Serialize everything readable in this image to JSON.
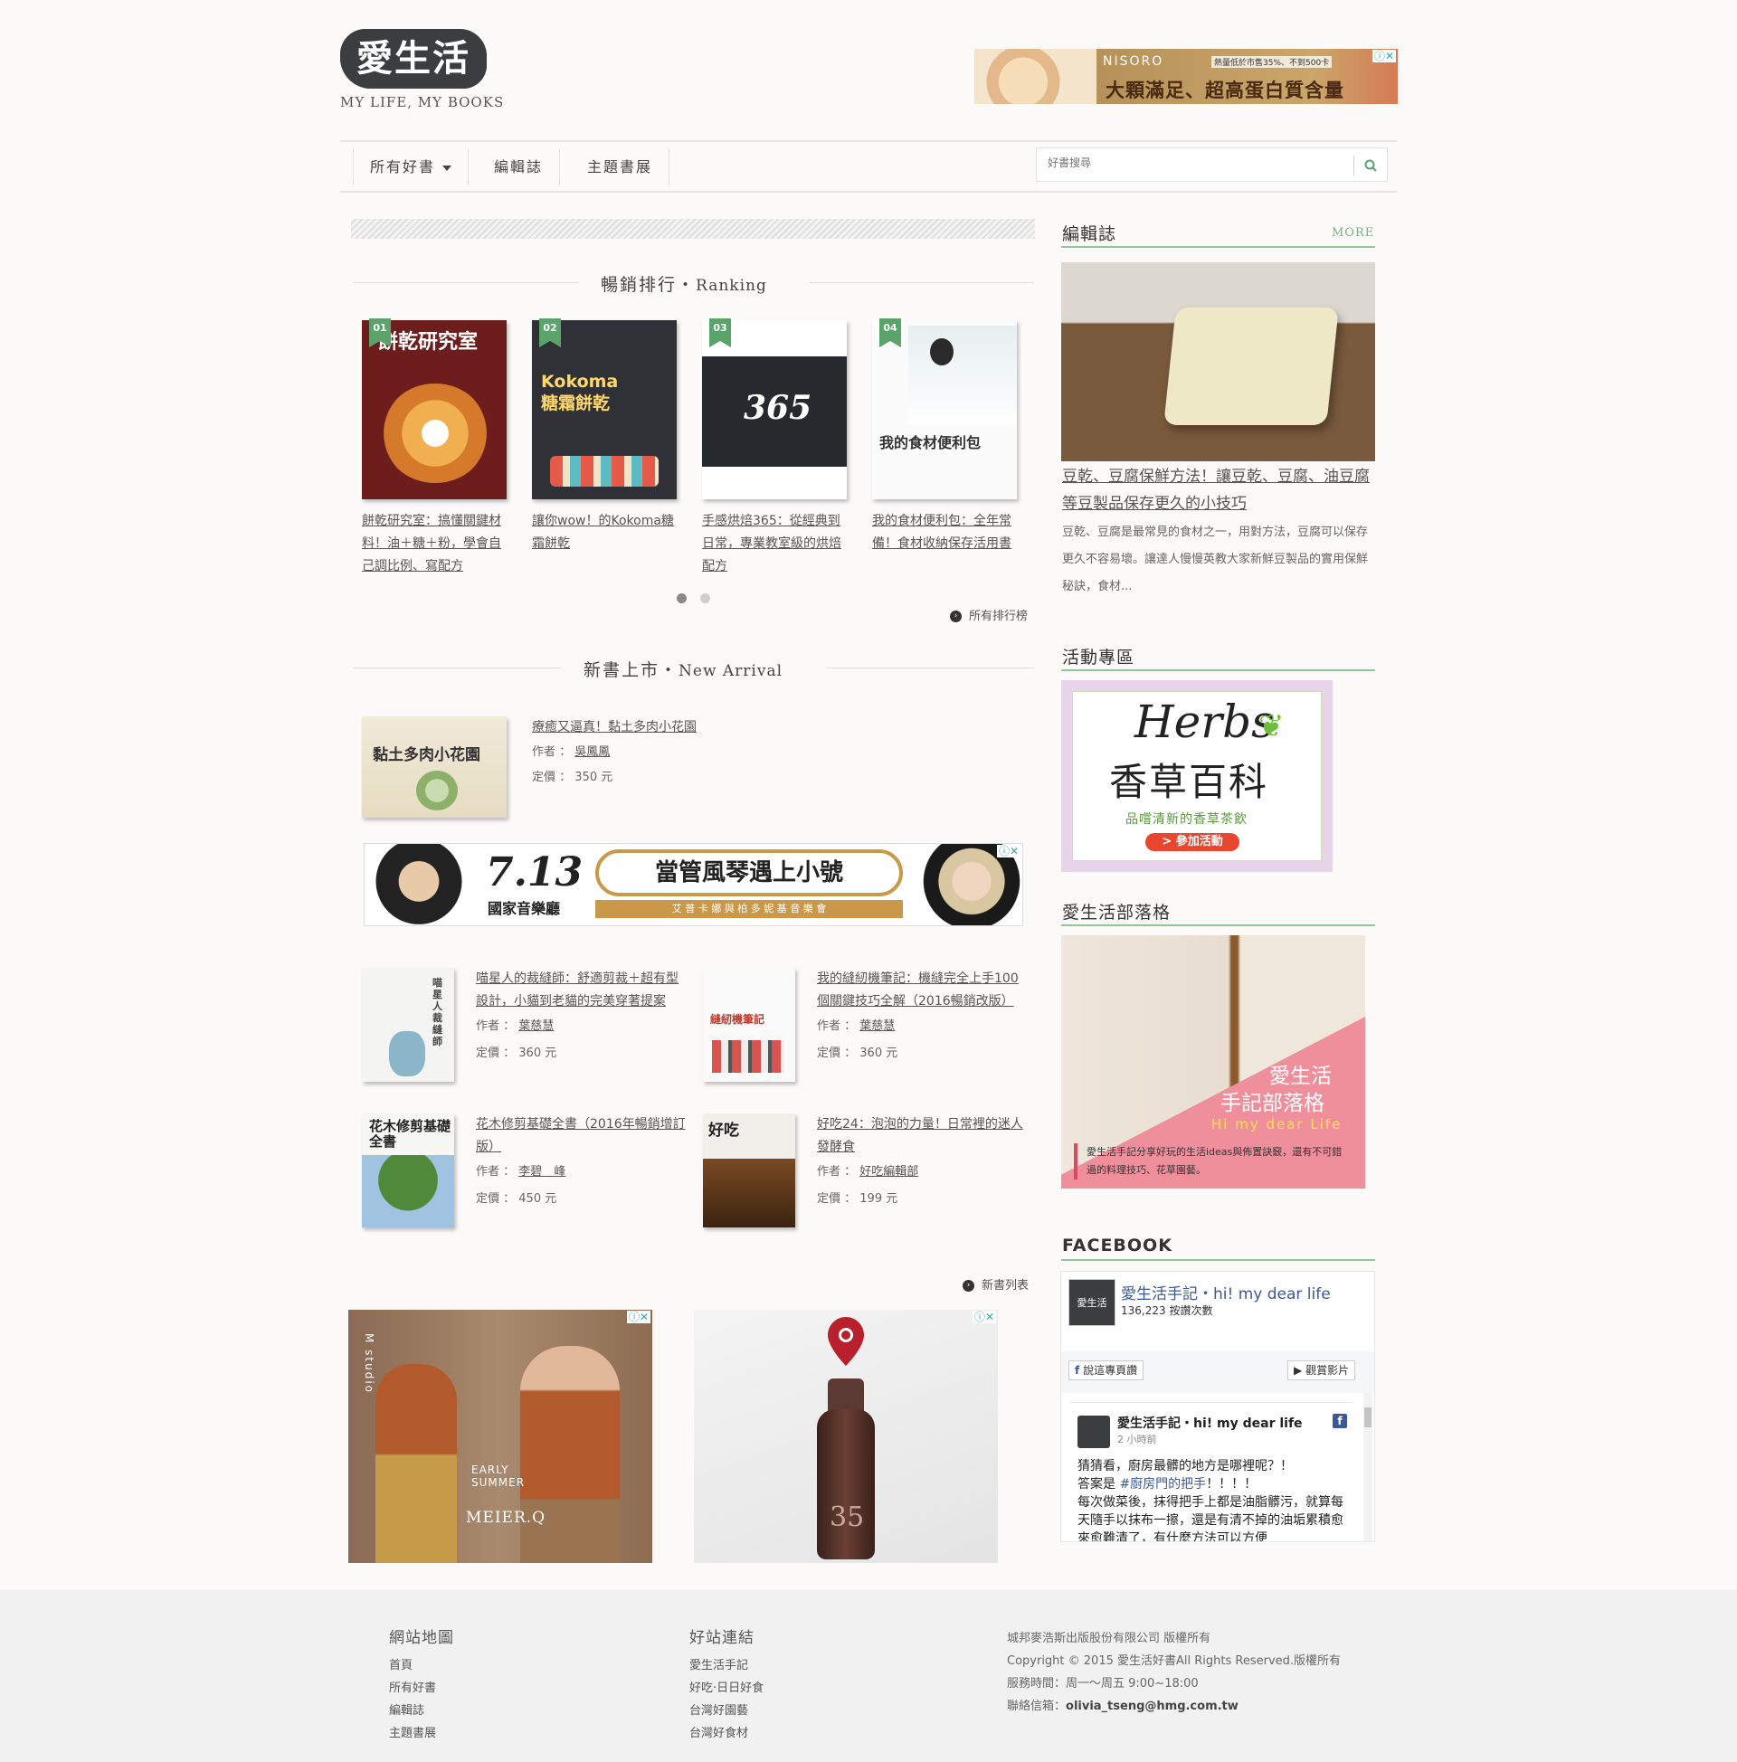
{
  "header": {
    "logo": "愛生活",
    "tagline": "MY LIFE, MY BOOKS",
    "top_ad": {
      "brand": "NISORO",
      "small": "熱量低於市售35%、不到500卡",
      "main": "大顆滿足、超高蛋白質含量"
    }
  },
  "nav": {
    "items": [
      "所有好書",
      "編輯誌",
      "主題書展"
    ],
    "search_placeholder": "好書搜尋"
  },
  "ranking": {
    "title_zh": "暢銷排行・",
    "title_en": "Ranking",
    "books": [
      {
        "rank": "01",
        "cover_text": "餅乾研究室",
        "title": "餅乾研究室：搞懂關鍵材料！油＋糖＋粉，學會自己調比例、寫配方"
      },
      {
        "rank": "02",
        "cover_text": "Kokoma 糖霜餅乾",
        "title": "讓你wow！的Kokoma糖霜餅乾"
      },
      {
        "rank": "03",
        "cover_text": "365",
        "title": "手感烘焙365：從經典到日常，專業教室級的烘焙配方"
      },
      {
        "rank": "04",
        "cover_text": "我的食材便利包",
        "title": "我的食材便利包：全年常備！食材收納保存活用書"
      }
    ],
    "more": "所有排行榜"
  },
  "new_arrival": {
    "title_zh": "新書上市・",
    "title_en": "New Arrival",
    "author_label": "作者 ：",
    "price_label": "定價 ：",
    "featured": {
      "cover_text": "黏土多肉小花園",
      "title": "療癒又逼真！黏土多肉小花園",
      "author": "吳鳳鳳",
      "price": "350 元"
    },
    "books": [
      {
        "cover_text": "喵星人裁縫師",
        "title": "喵星人的裁縫師：舒適剪裁＋超有型設計，小貓到老貓的完美穿著提案",
        "author": "葉慈慧",
        "price": "360 元"
      },
      {
        "cover_text": "縫紉機筆記",
        "title": "我的縫紉機筆記：機縫完全上手100個關鍵技巧全解（2016暢銷改版）",
        "author": "葉慈慧",
        "price": "360 元"
      },
      {
        "cover_text": "花木修剪基礎全書",
        "title": "花木修剪基礎全書（2016年暢銷增訂版）",
        "author": "李碧　峰",
        "price": "450 元"
      },
      {
        "cover_text": "好吃",
        "title": "好吃24：泡泡的力量！日常裡的迷人發酵食",
        "author": "好吃編輯部",
        "price": "199 元"
      }
    ],
    "more": "新書列表"
  },
  "mid_ad": {
    "date": "7.13",
    "venue": "國家音樂廳",
    "headline": "當管風琴遇上小號",
    "sub": "艾 普 卡 娜 與 柏 多 妮 基 音 樂 會"
  },
  "bottom_ads": [
    {
      "brand": "M studio",
      "season": "EARLY SUMMER",
      "name": "MEIER.Q"
    },
    {
      "label": "35"
    }
  ],
  "sidebar": {
    "magazine": {
      "heading": "編輯誌",
      "more": "MORE",
      "article_title": "豆乾、豆腐保鮮方法！讓豆乾、豆腐、油豆腐等豆製品保存更久的小技巧",
      "excerpt": "豆乾、豆腐是最常見的食材之一，用對方法，豆腐可以保存更久不容易壞。讓達人慢慢英教大家新鮮豆製品的實用保鮮秘訣，食材..."
    },
    "events": {
      "heading": "活動專區",
      "banner_en": "Herbs",
      "banner_zh": "香草百科",
      "banner_sub": "品嚐清新的香草茶飲",
      "banner_btn": "> 參加活動"
    },
    "blog": {
      "heading": "愛生活部落格",
      "banner_title_1": "愛生活",
      "banner_title_2": "手記部落格",
      "banner_sub": "Hi my dear Life",
      "banner_desc": "愛生活手記分享好玩的生活ideas與佈置訣竅，還有不可錯過的料理技巧、花草園藝。"
    },
    "facebook": {
      "heading": "FACEBOOK",
      "page_name": "愛生活手記・hi! my dear life",
      "likes": "136,223 按讚次數",
      "like_btn": "說這專頁讚",
      "video_btn": "觀賞影片",
      "post_author": "愛生活手記・hi! my dear life",
      "post_time": "2 小時前",
      "post_line1": "猜猜看，廚房最髒的地方是哪裡呢？！",
      "post_line2_prefix": "答案是",
      "post_tag": "#廚房門的把手",
      "post_line2_suffix": "！！！！",
      "post_line3": "每次做菜後，抹得把手上都是油脂髒污，就算每天隨手以抹布一擦，還是有清不掉的油垢累積愈來愈難清了，有什麼方法可以方便"
    }
  },
  "footer": {
    "sitemap_heading": "網站地圖",
    "sitemap_links": [
      "首頁",
      "所有好書",
      "編輯誌",
      "主題書展"
    ],
    "links_heading": "好站連結",
    "links": [
      "愛生活手記",
      "好吃·日日好食",
      "台灣好園藝",
      "台灣好食材"
    ],
    "company": "城邦麥浩斯出版股份有限公司 版權所有",
    "copyright": "Copyright © 2015 愛生活好書All Rights Reserved.版權所有",
    "hours": "服務時間：周一～周五 9:00~18:00",
    "contact_label": "聯絡信箱：",
    "contact_email": "olivia_tseng@hmg.com.tw"
  },
  "colors": {
    "accent_green": "#5aa36a",
    "side_rule": "#8fc79b",
    "blog_pink": "#ef8f9c",
    "fb_blue": "#3b5998"
  }
}
